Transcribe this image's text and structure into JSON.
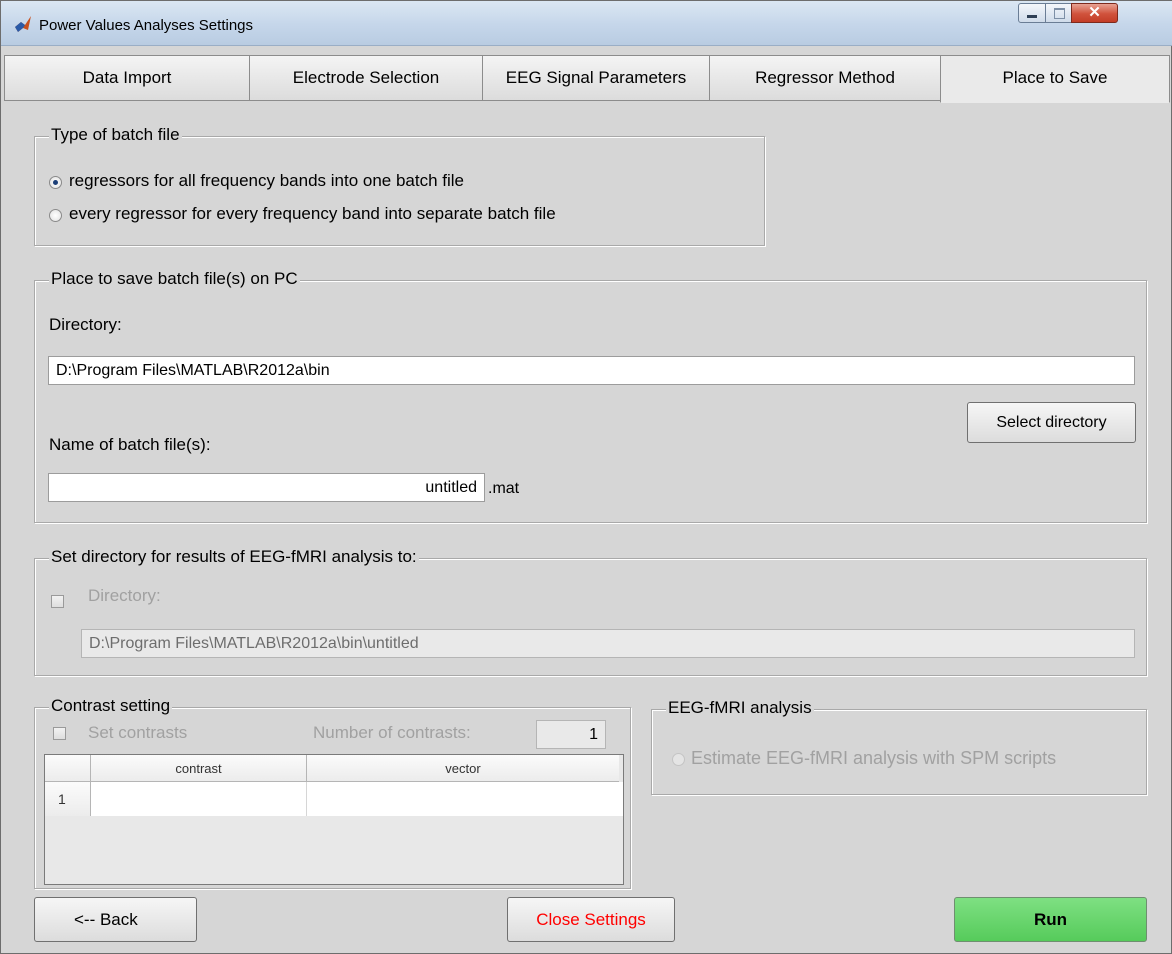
{
  "window": {
    "title": "Power Values Analyses Settings"
  },
  "tabs": [
    {
      "label": "Data Import"
    },
    {
      "label": "Electrode Selection"
    },
    {
      "label": "EEG Signal Parameters"
    },
    {
      "label": "Regressor Method"
    },
    {
      "label": "Place to Save"
    }
  ],
  "batch_type": {
    "legend": "Type of batch file",
    "option_one": "regressors for all frequency bands into one batch file",
    "option_separate": "every regressor for every frequency band into separate batch file",
    "selected": "option_one"
  },
  "save_place": {
    "legend": "Place to save batch file(s) on PC",
    "directory_label": "Directory:",
    "directory_value": "D:\\Program Files\\MATLAB\\R2012a\\bin",
    "select_button": "Select directory",
    "name_label": "Name of batch file(s):",
    "name_value": "untitled",
    "extension": ".mat"
  },
  "results_dir": {
    "legend": "Set directory for results of EEG-fMRI analysis to:",
    "checkbox_label": "Directory:",
    "directory_value": "D:\\Program Files\\MATLAB\\R2012a\\bin\\untitled"
  },
  "contrast": {
    "legend": "Contrast setting",
    "checkbox_label": "Set contrasts",
    "count_label": "Number of contrasts:",
    "count_value": "1",
    "columns": [
      "contrast",
      "vector"
    ],
    "rows": [
      {
        "index": "1",
        "contrast": "",
        "vector": ""
      }
    ]
  },
  "analysis": {
    "legend": "EEG-fMRI analysis",
    "option": "Estimate EEG-fMRI analysis with SPM scripts"
  },
  "footer": {
    "back": "<-- Back",
    "close": "Close Settings",
    "run": "Run"
  },
  "colors": {
    "close_text": "#ff0000",
    "run_bg": "#66d76a"
  }
}
